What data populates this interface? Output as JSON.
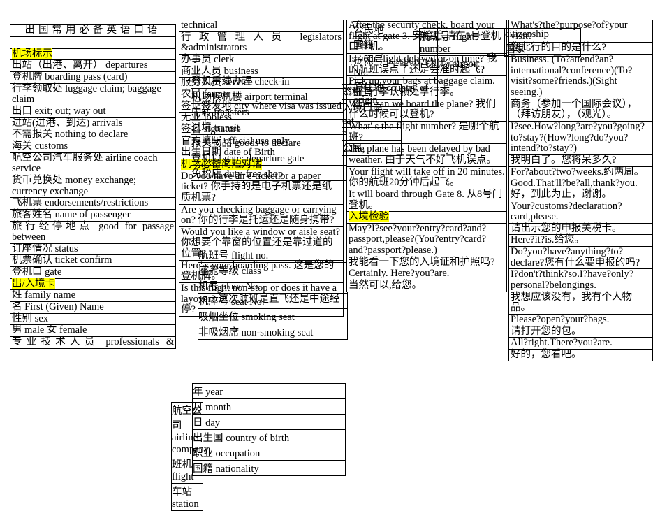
{
  "document": {
    "title": "出国常用必备英语口语",
    "highlight_color": "#ffff00",
    "title_color": "#3366cc"
  },
  "col1": {
    "heading": "机场标示",
    "heading2": "出/入境卡",
    "rows": [
      "出站（出港、离开） departures",
      "登机牌 boarding pass (card)",
      "行李领取处 luggage claim; baggage claim",
      "出口 exit; out; way out",
      "进站(进港、到达) arrivals",
      "不需报关 nothing to declare",
      "海关 customs",
      "航空公司汽车服务处 airline coach service",
      "货币兑换处 money exchange; currency exchange",
      "飞机票 endorsements/restrictions",
      "旅客姓名 name of passenger",
      "旅行经停地点 good for passage between",
      "订座情况 status",
      "机票确认 ticket confirm",
      "登机口 gate"
    ],
    "rows2": [
      "姓 family name",
      "名 First (Given) Name",
      "性别 sex",
      "男 male  女 female",
      "专业技术人员 professionals &"
    ]
  },
  "col2": {
    "rows": [
      "technical",
      "行政管理人员 legislators &administrators",
      "办事员 clerk",
      "商业人员 business",
      "服务人员 service",
      "农民 farmer",
      "签证签发地 city where visa was issued",
      "无业 jobless",
      "签名 signature",
      "官方填写 official use only",
      "出生日期 date of Birth"
    ],
    "heading": "机场必备简短对话",
    "rows2": [
      "Do you have an e-ticket or a paper ticket?  你手持的是电子机票还是纸质机票?",
      "Are you checking baggage or carrying on?  你的行李是托运还是随身携带?",
      "Would you like a window or aisle seat?  你想要个靠窗的位置还是靠过道的位置?",
      "Here' s your boarding pass.  这是您的登机牌。",
      "Is this flight non-stop or does it have a layover? 这次航班是直飞还是中途经停?"
    ]
  },
  "col2_overlay_a": {
    "rows": [
      "登机手续办理 check-in",
      "机场候机楼 airport terminal",
      "中转 transfers",
      "过境 transit",
      "报关物品 goods to declare",
      "登机口 gate; departure gate",
      "免税店 duty-free shop"
    ]
  },
  "col2_overlay_b": {
    "rows": [
      "航班号 flight no.",
      "座舱等级 class",
      "机号 plane No.",
      "机座号 seat No.",
      "吸烟坐位 smoking seat",
      "非吸烟席 non-smoking seat"
    ]
  },
  "col2_overlay_c": {
    "rows": [
      "年 year",
      "月 month",
      "日 day",
      "出生国 country of birth",
      "职业 occupation",
      "国籍 nationality"
    ]
  },
  "col2_overlay_d": {
    "rows": [
      "航空公司 airline company",
      "班机 flight",
      "车站 station"
    ]
  },
  "col3": {
    "heading": "入境检验",
    "rows": [
      "After the security check, board your flight at gate 3.  安检后,请在3号登机口登机。",
      "Is your flight delayed or on time?  我的航班误点了还是会准时起飞?",
      "Pick up your bags at baggage claim.   请在行李认领处拿行李。",
      "When can we board the plane?  我们什么时候可以登机?",
      "What' s the flight number?  是哪个航班?",
      "The plane has been delayed by bad weather.   由于天气不好飞机误点。",
      "Your flight will take off in 20 minutes.  你的航班20分钟后起飞。",
      "It will board through Gate 8.   从8号门登机。"
    ],
    "rows2": [
      "May?I?see?your?entry?card?and?passport,please?(You?entry?card?and?passport?please.)",
      "我能看一下您的入境证和护照吗?",
      "Certainly. Here?you?are.",
      "当然可以,给您。"
    ]
  },
  "col3_overlay_a": {
    "rows": [
      "公民地",
      "国籍",
      "护照号 passport No.",
      "原住地 country of origin"
    ]
  },
  "col3_overlay_b": {
    "rows": [
      "签证号",
      "入境口岸",
      "eat",
      "r",
      "公民,"
    ]
  },
  "col3_overlay_c": {
    "rows": [
      "航班号 flight number",
      "飞机场 airport"
    ]
  },
  "col4": {
    "rows": [
      "What's?the?purpose?of?your visit?",
      "您此行的目的是什么?",
      "Business. (To?attend?an?international?conference)(To?visit?some?friends.)(Sight seeing.)",
      "商务（参加一个国际会议），（拜访朋友），（观光）。",
      "I?see.How?long?are?you?going?to?stay?(How?long?do?you?intend?to?stay?)",
      "我明白了。您将呆多久?",
      "For?about?two?weeks.约两周。",
      "Good.That'll?be?all,thank?you.好，到此为止，谢谢。",
      "Your?customs?declaration?card,please.",
      "请出示您的申报关税卡。",
      "Here?it?is.给您。",
      "Do?you?have?anything?to?declare?您有什么要申报的吗?",
      "I?don't?think?so.I?have?only?personal?belongings.",
      "我想应该没有，我有个人物品。",
      "Please?open?your?bags.",
      "请打开您的包。",
      "All?right.There?you?are.",
      "好的，您看吧。"
    ]
  },
  "col4_overlay": {
    "rows": [
      "citizenship",
      "国家"
    ]
  }
}
